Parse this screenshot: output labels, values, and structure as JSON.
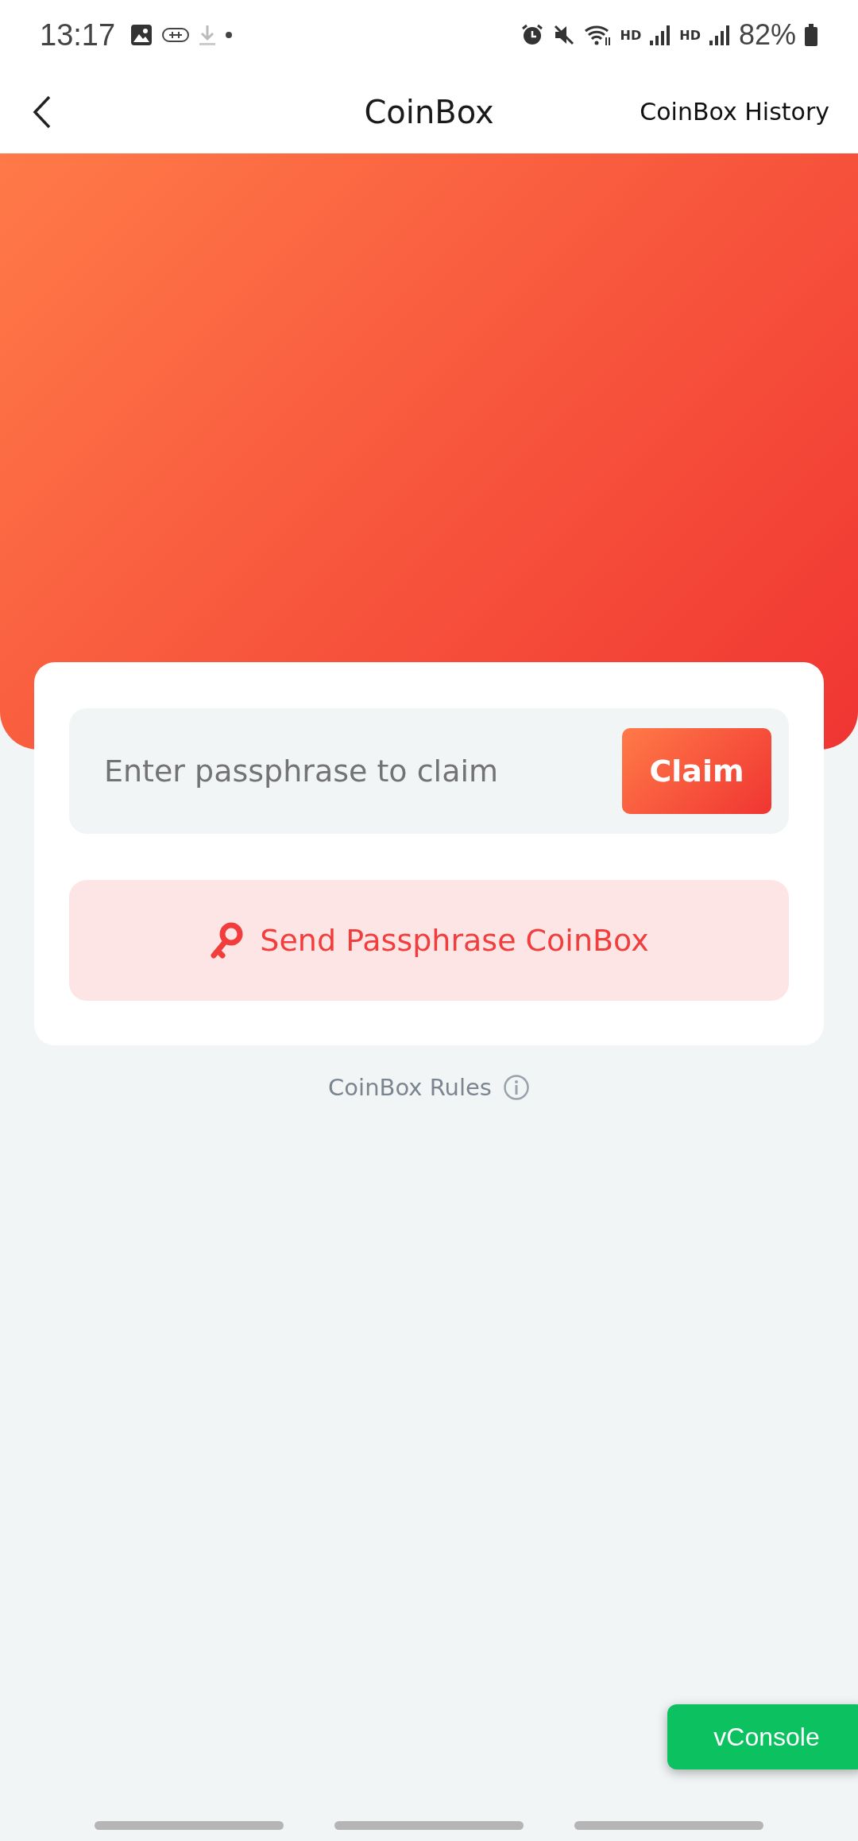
{
  "status_bar": {
    "time": "13:17",
    "battery": "82%",
    "network_labels": [
      "HD",
      "HD"
    ]
  },
  "header": {
    "title": "CoinBox",
    "action": "CoinBox History"
  },
  "claim": {
    "placeholder": "Enter passphrase to claim",
    "button": "Claim"
  },
  "send_button": "Send Passphrase CoinBox",
  "rules_link": "CoinBox Rules",
  "debug_button": "vConsole"
}
